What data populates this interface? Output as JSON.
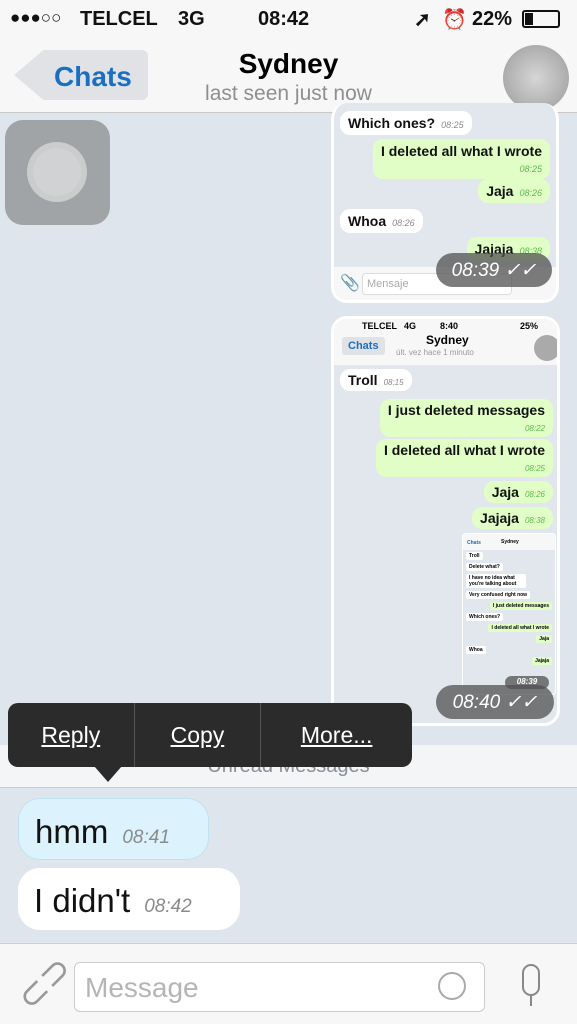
{
  "status": {
    "signal": "●●●○○",
    "carrier": "TELCEL",
    "network": "3G",
    "time": "08:42",
    "battery": "22%",
    "icons": [
      "location-arrow-icon",
      "alarm-icon",
      "battery-icon"
    ]
  },
  "nav": {
    "back": "Chats",
    "title": "Sydney",
    "subtitle": "last seen just now"
  },
  "shot1": {
    "messages": [
      {
        "text": "Which ones?",
        "time": "08:25",
        "dir": "in"
      },
      {
        "text": "I deleted all what I wrote",
        "time": "08:25",
        "dir": "out"
      },
      {
        "text": "Jaja",
        "time": "08:26",
        "dir": "out"
      },
      {
        "text": "Whoa",
        "time": "08:26",
        "dir": "in"
      },
      {
        "text": "Jajaja",
        "time": "08:38",
        "dir": "out"
      }
    ],
    "input_placeholder": "Mensaje",
    "stamp": "08:39"
  },
  "shot2": {
    "status": {
      "carrier": "TELCEL",
      "network": "4G",
      "time": "8:40",
      "battery": "25%"
    },
    "back": "Chats",
    "title": "Sydney",
    "subtitle": "últ. vez hace 1 minuto",
    "messages": [
      {
        "text": "Troll",
        "time": "08:15",
        "dir": "in"
      },
      {
        "text": "I just deleted messages",
        "time": "08:22",
        "dir": "out"
      },
      {
        "text": "I deleted all what I wrote",
        "time": "08:25",
        "dir": "out"
      },
      {
        "text": "Jaja",
        "time": "08:26",
        "dir": "out"
      },
      {
        "text": "Jajaja",
        "time": "08:38",
        "dir": "out"
      }
    ],
    "inner": {
      "title": "Sydney",
      "back": "Chats",
      "messages": [
        "Troll",
        "Delete what?",
        "I have no idea what you're talking about",
        "Very confused right now",
        "I just deleted messages",
        "Which ones?",
        "I deleted all what I wrote",
        "Jaja",
        "Whoa",
        "Jajaja"
      ],
      "stamp": "08:39"
    },
    "stamp": "08:40"
  },
  "popup": {
    "reply": "Reply",
    "copy": "Copy",
    "more": "More..."
  },
  "unread": "Unread Messages",
  "messages": [
    {
      "text": "hmm",
      "time": "08:41"
    },
    {
      "text": "I didn't",
      "time": "08:42"
    }
  ],
  "input": {
    "placeholder": "Message"
  },
  "colors": {
    "accent": "#1a6fc2",
    "outgoing": "#e1fec6",
    "selected": "#dcf3fd",
    "chat_bg": "#dfe5ec"
  }
}
